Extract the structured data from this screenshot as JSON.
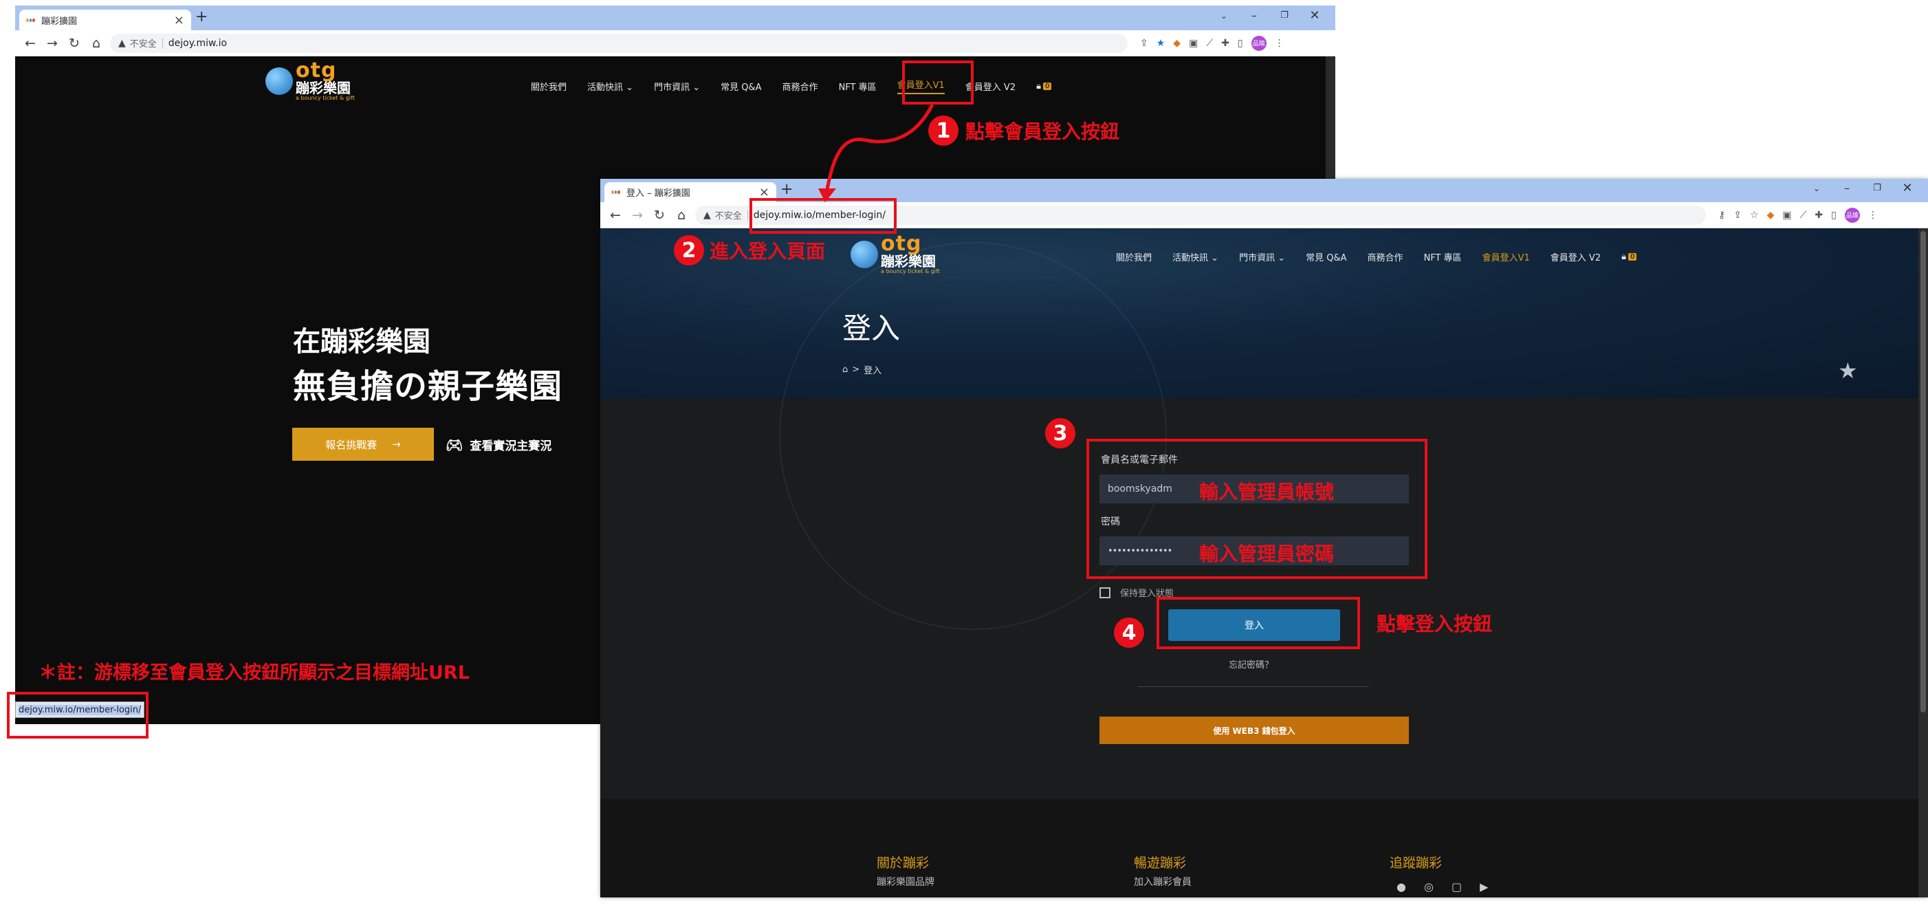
{
  "browser_back": {
    "tab_title": "蹦彩擴園",
    "url_not_secure": "不安全",
    "url": "dejoy.miw.io",
    "status_url": "dejoy.miw.io/member-login/"
  },
  "browser_front": {
    "tab_title": "登入 – 蹦彩擴園",
    "url_not_secure": "不安全",
    "url": "dejoy.miw.io/member-login/"
  },
  "profile_avatar_text": "品瑜",
  "site": {
    "logo_mark": "otg",
    "logo_name": "蹦彩樂園",
    "logo_tagline": "a bouncy ticket & gift",
    "nav": [
      {
        "label": "關於我們",
        "dropdown": false
      },
      {
        "label": "活動快訊",
        "dropdown": true
      },
      {
        "label": "門市資訊",
        "dropdown": true
      },
      {
        "label": "常見 Q&A",
        "dropdown": false
      },
      {
        "label": "商務合作",
        "dropdown": false
      },
      {
        "label": "NFT 專區",
        "dropdown": false
      },
      {
        "label": "會員登入V1",
        "dropdown": false
      },
      {
        "label": "會員登入 V2",
        "dropdown": false
      }
    ],
    "cart_count": "0"
  },
  "hero": {
    "line1": "在蹦彩樂園",
    "line2": "無負擔の親子樂園",
    "cta_label": "報名挑戰賽",
    "cta_arrow": "→",
    "secondary_label": "查看實況主賽況"
  },
  "login_page": {
    "title": "登入",
    "breadcrumb_sep": ">",
    "breadcrumb_current": "登入",
    "username_label": "會員名或電子郵件",
    "username_value": "boomskyadm",
    "password_label": "密碼",
    "password_value": "••••••••••••••",
    "remember_label": "保持登入狀態",
    "submit_label": "登入",
    "forgot_label": "忘記密碼？",
    "web3_label": "使用 WEB3 錢包登入"
  },
  "footer": {
    "col1": "關於蹦彩",
    "col1_item": "蹦彩樂園品牌",
    "col2": "暢遊蹦彩",
    "col2_item": "加入蹦彩會員",
    "col3": "追蹤蹦彩"
  },
  "annotations": {
    "step1_num": "1",
    "step1_text": "點擊會員登入按鈕",
    "step2_num": "2",
    "step2_text": "進入登入頁面",
    "step3_num": "3",
    "step4_num": "4",
    "step4_text": "點擊登入按鈕",
    "input_user_text": "輸入管理員帳號",
    "input_pass_text": "輸入管理員密碼",
    "note": "＊註：游標移至會員登入按鈕所顯示之目標網址URL"
  },
  "colors": {
    "accent_orange": "#d89a1a",
    "annotation_red": "#e8101a",
    "login_button": "#1f72a8",
    "web3_button": "#c1700c"
  }
}
